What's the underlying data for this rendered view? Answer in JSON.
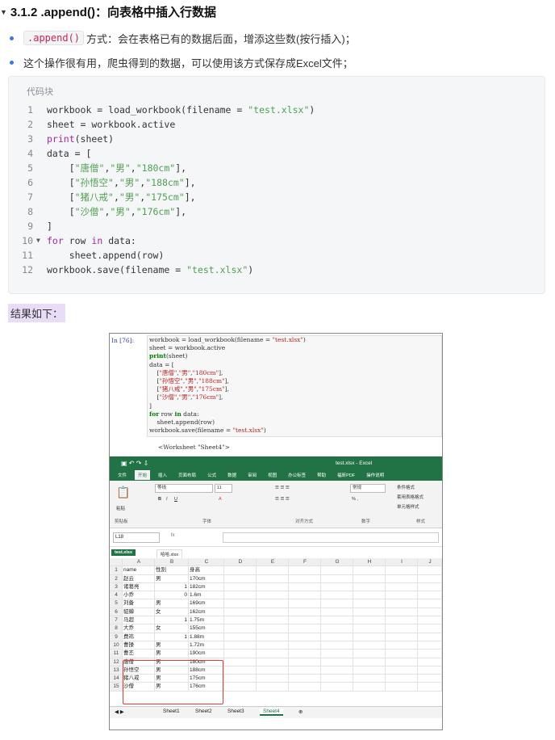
{
  "heading": "3.1.2 .append()：向表格中插入行数据",
  "bullets": [
    {
      "code": ".append()",
      "text": "方式：会在表格已有的数据后面，增添这些数(按行插入)；"
    },
    {
      "code": "",
      "text": "这个操作很有用，爬虫得到的数据，可以使用该方式保存成Excel文件；"
    }
  ],
  "code_block": {
    "label": "代码块",
    "lines": [
      {
        "n": "1",
        "fold": false,
        "text": "workbook = load_workbook(filename = \"test.xlsx\")"
      },
      {
        "n": "2",
        "fold": false,
        "text": "sheet = workbook.active"
      },
      {
        "n": "3",
        "fold": false,
        "text": "print(sheet)"
      },
      {
        "n": "4",
        "fold": false,
        "text": "data = ["
      },
      {
        "n": "5",
        "fold": false,
        "text": "    [\"唐僧\",\"男\",\"180cm\"],"
      },
      {
        "n": "6",
        "fold": false,
        "text": "    [\"孙悟空\",\"男\",\"188cm\"],"
      },
      {
        "n": "7",
        "fold": false,
        "text": "    [\"猪八戒\",\"男\",\"175cm\"],"
      },
      {
        "n": "8",
        "fold": false,
        "text": "    [\"沙僧\",\"男\",\"176cm\"],"
      },
      {
        "n": "9",
        "fold": false,
        "text": "]"
      },
      {
        "n": "10",
        "fold": true,
        "text": "for row in data:"
      },
      {
        "n": "11",
        "fold": false,
        "text": "    sheet.append(row)"
      },
      {
        "n": "12",
        "fold": false,
        "text": "workbook.save(filename = \"test.xlsx\")"
      }
    ]
  },
  "result_label": "结果如下：",
  "jupyter": {
    "in_label": "In  [76]:",
    "lines": [
      "workbook = load_workbook(filename = \"test.xlsx\")",
      "sheet = workbook.active",
      "print(sheet)",
      "data = [",
      "    [\"唐僧\",\"男\",\"180cm\"],",
      "    [\"孙悟空\",\"男\",\"188cm\"],",
      "    [\"猪八戒\",\"男\",\"175cm\"],",
      "    [\"沙僧\",\"男\",\"176cm\"],",
      "]",
      "for row in data:",
      "    sheet.append(row)",
      "workbook.save(filename = \"test.xlsx\")"
    ],
    "output": "<Worksheet \"Sheet4\">"
  },
  "excel": {
    "title": "test.xlsx - Excel",
    "ribbon_tabs": [
      "文件",
      "开始",
      "插入",
      "页面布局",
      "公式",
      "数据",
      "审阅",
      "视图",
      "办公标签",
      "帮助",
      "福昕PDF",
      "操作说明"
    ],
    "active_tab": "开始",
    "font_name": "等线",
    "font_size": "11",
    "number_format": "常规",
    "groups": [
      "剪贴板",
      "字体",
      "对齐方式",
      "数字",
      "样式"
    ],
    "style_items": [
      "条件格式",
      "套用表格格式",
      "单元格样式"
    ],
    "paste_label": "粘贴",
    "name_box": "L18",
    "fx": "fx",
    "workbook_tabs": [
      "test.xlsx",
      "哈哈.xlsx"
    ],
    "col_headers": [
      "A",
      "B",
      "C",
      "D",
      "E",
      "F",
      "G",
      "H",
      "I",
      "J"
    ],
    "rows": [
      [
        "1",
        "name",
        "性别",
        "身高"
      ],
      [
        "2",
        "赵云",
        "男",
        "170cm"
      ],
      [
        "3",
        "诸葛亮",
        "1",
        "182cm"
      ],
      [
        "4",
        "小乔",
        "0",
        "1.6m"
      ],
      [
        "5",
        "刘备",
        "男",
        "169cm"
      ],
      [
        "6",
        "貂蝉",
        "女",
        "162cm"
      ],
      [
        "7",
        "马超",
        "1",
        "1.75m"
      ],
      [
        "8",
        "大乔",
        "女",
        "155cm"
      ],
      [
        "9",
        "费祎",
        "1",
        "1.88m"
      ],
      [
        "10",
        "曹操",
        "男",
        "1.72m"
      ],
      [
        "11",
        "曹丕",
        "男",
        "190cm"
      ],
      [
        "12",
        "唐僧",
        "男",
        "180cm"
      ],
      [
        "13",
        "孙悟空",
        "男",
        "188cm"
      ],
      [
        "14",
        "猪八戒",
        "男",
        "175cm"
      ],
      [
        "15",
        "沙僧",
        "男",
        "176cm"
      ]
    ],
    "sheet_tabs": [
      "Sheet1",
      "Sheet2",
      "Sheet3",
      "Sheet4"
    ],
    "active_sheet": "Sheet4"
  }
}
